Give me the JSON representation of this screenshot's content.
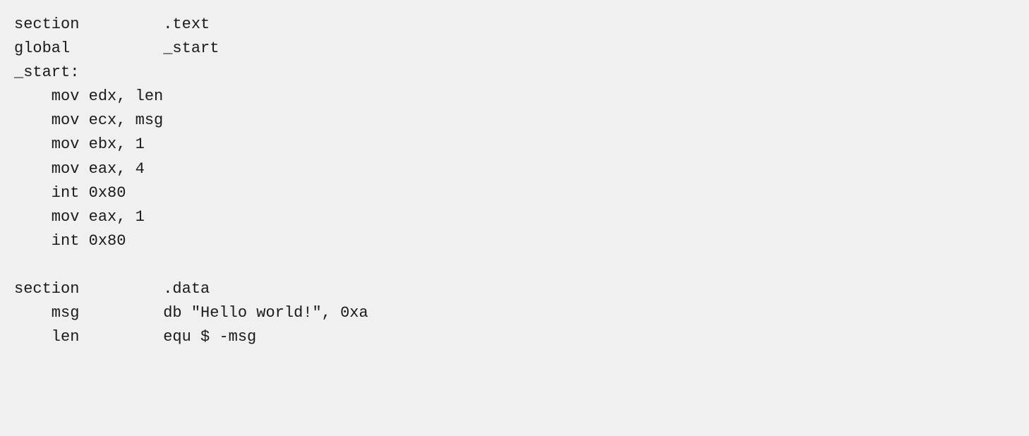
{
  "code": {
    "lines": [
      "section         .text",
      "global          _start",
      "_start:",
      "    mov edx, len",
      "    mov ecx, msg",
      "    mov ebx, 1",
      "    mov eax, 4",
      "    int 0x80",
      "    mov eax, 1",
      "    int 0x80",
      "",
      "section         .data",
      "    msg         db \"Hello world!\", 0xa",
      "    len         equ $ -msg"
    ]
  }
}
